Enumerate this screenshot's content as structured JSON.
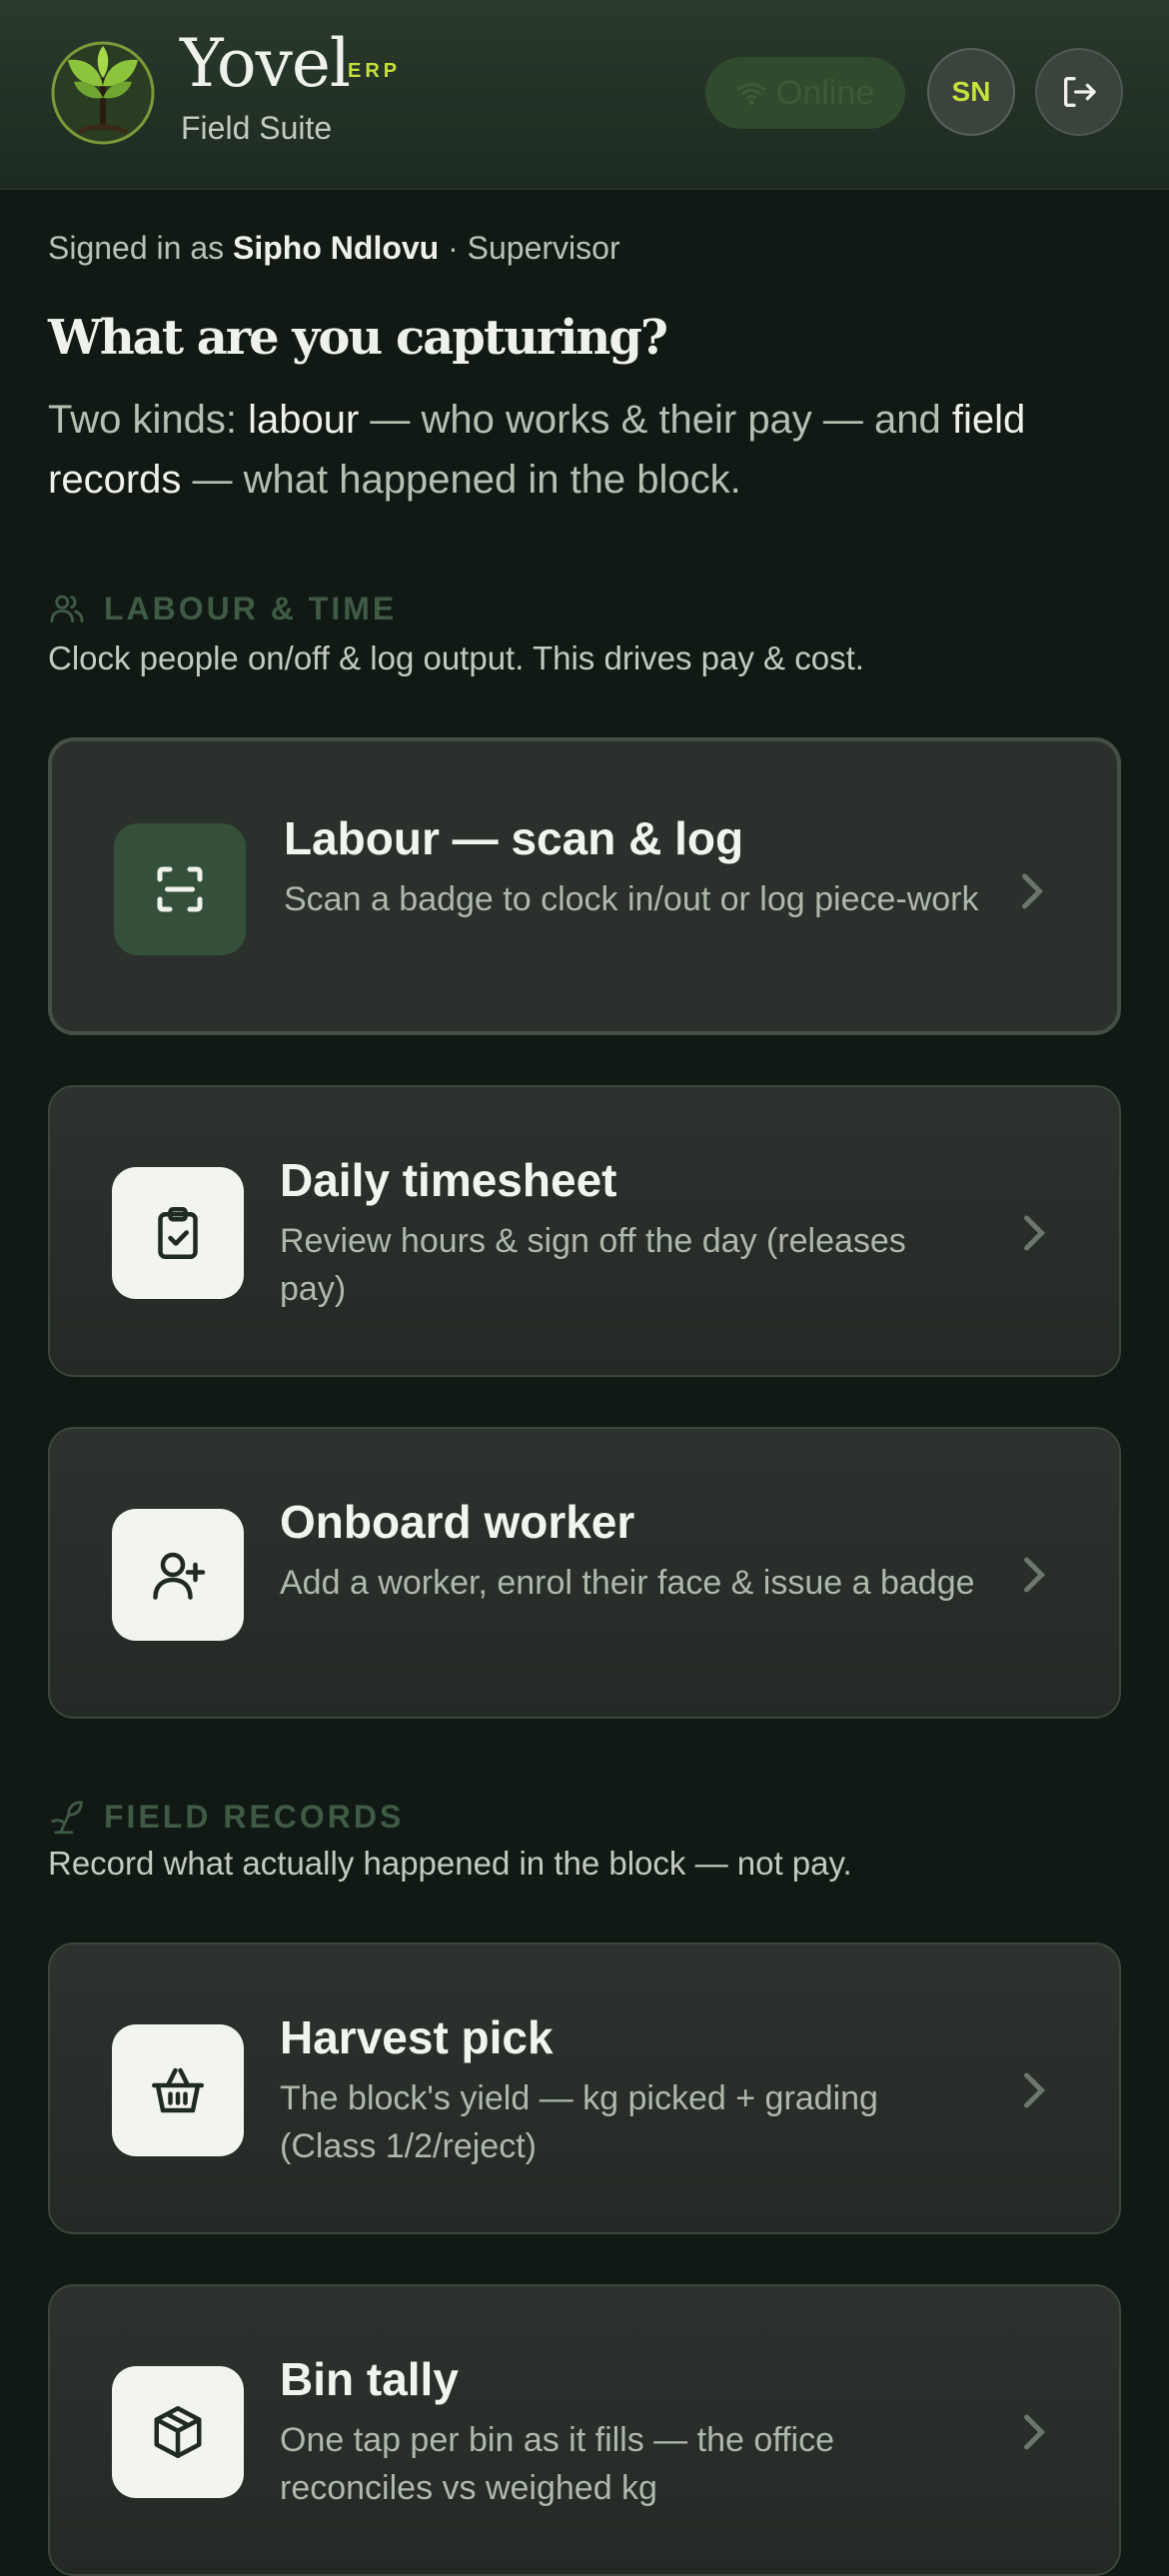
{
  "header": {
    "brand": "Yovel",
    "brand_tag": "ERP",
    "subtitle": "Field Suite",
    "status": "Online",
    "avatar_initials": "SN"
  },
  "session": {
    "prefix": "Signed in as",
    "user": "Sipho Ndlovu",
    "separator": "·",
    "role": "Supervisor"
  },
  "intro": {
    "title": "What are you capturing?",
    "t1": "Two kinds:",
    "b1": "labour",
    "t2": "— who works & their pay — and",
    "b2": "field records",
    "t3": "— what happened in the block."
  },
  "sections": [
    {
      "heading": "LABOUR & TIME",
      "description": "Clock people on/off & log output. This drives pay & cost.",
      "cards": [
        {
          "title": "Labour — scan & log",
          "subtitle": "Scan a badge to clock in/out or log piece-work",
          "icon": "scan-icon"
        },
        {
          "title": "Daily timesheet",
          "subtitle": "Review hours & sign off the day (releases pay)",
          "icon": "clipboard-check-icon"
        },
        {
          "title": "Onboard worker",
          "subtitle": "Add a worker, enrol their face & issue a badge",
          "icon": "user-plus-icon"
        }
      ]
    },
    {
      "heading": "FIELD RECORDS",
      "description": "Record what actually happened in the block — not pay.",
      "cards": [
        {
          "title": "Harvest pick",
          "subtitle": "The block's yield — kg picked + grading (Class 1/2/reject)",
          "icon": "basket-icon"
        },
        {
          "title": "Bin tally",
          "subtitle": "One tap per bin as it fills — the office reconciles vs weighed kg",
          "icon": "box-icon"
        }
      ]
    }
  ],
  "colors": {
    "background": "#111915",
    "accent": "#c6e03c",
    "card": "#2a302b",
    "tile_active": "#34503a"
  }
}
